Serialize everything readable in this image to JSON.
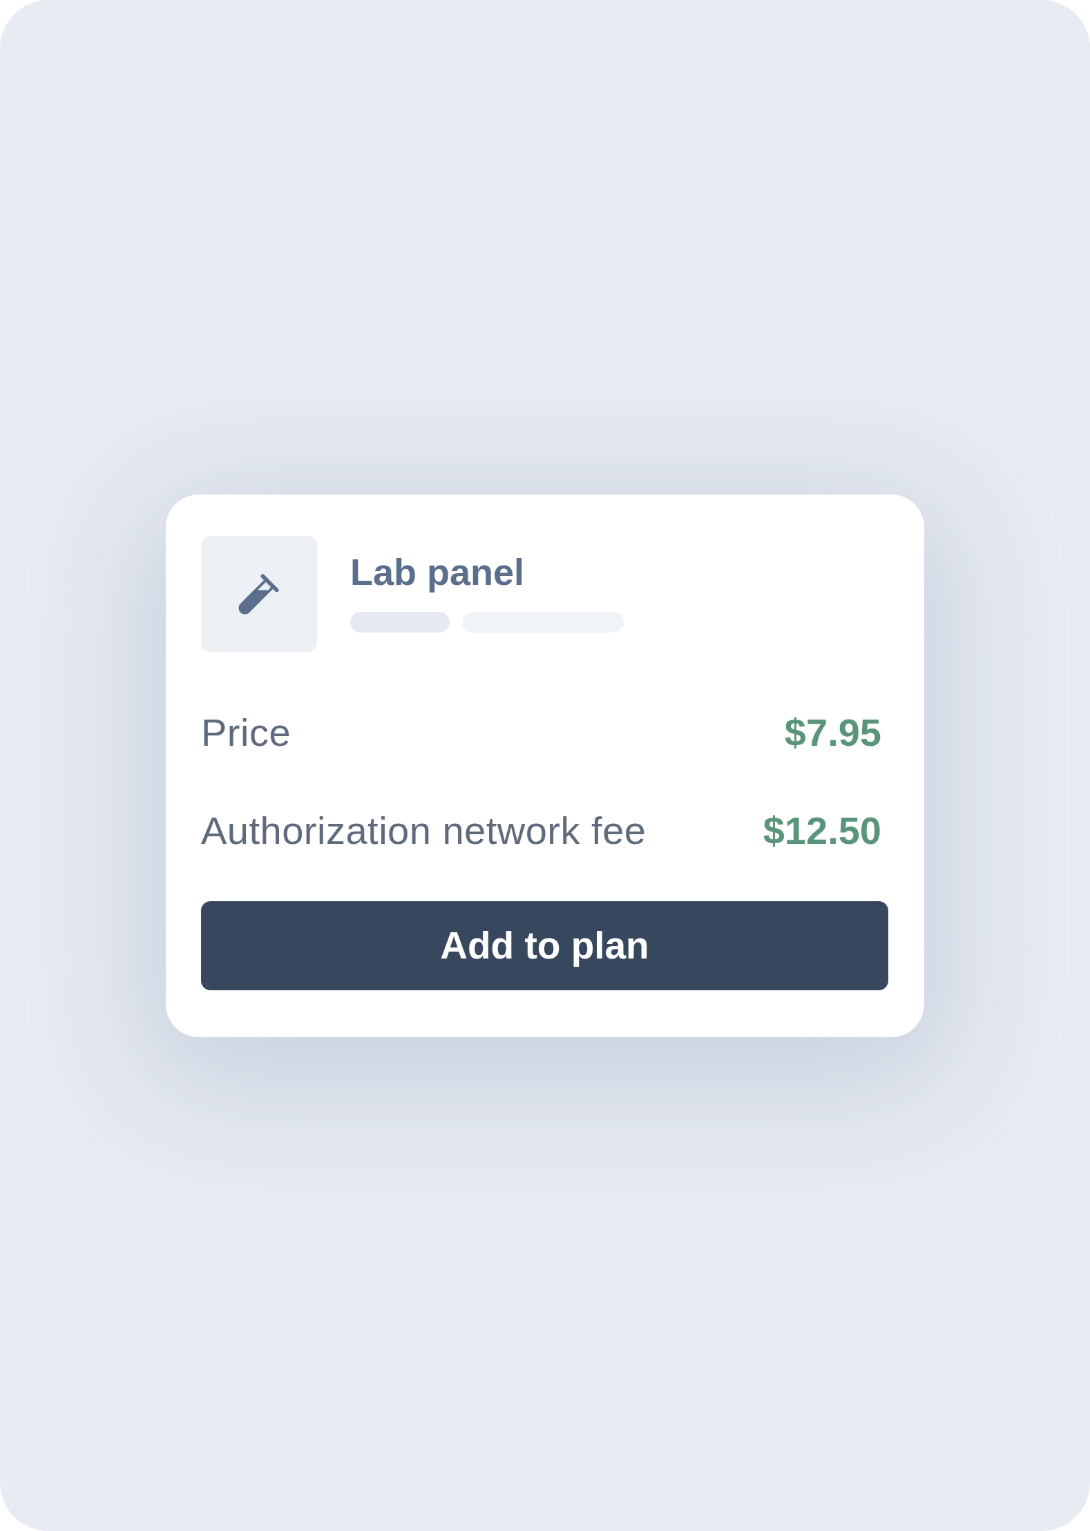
{
  "product": {
    "title": "Lab panel"
  },
  "line_items": [
    {
      "label": "Price",
      "amount": "$7.95"
    },
    {
      "label": "Authorization network fee",
      "amount": "$12.50"
    }
  ],
  "button": {
    "label": "Add to plan"
  }
}
